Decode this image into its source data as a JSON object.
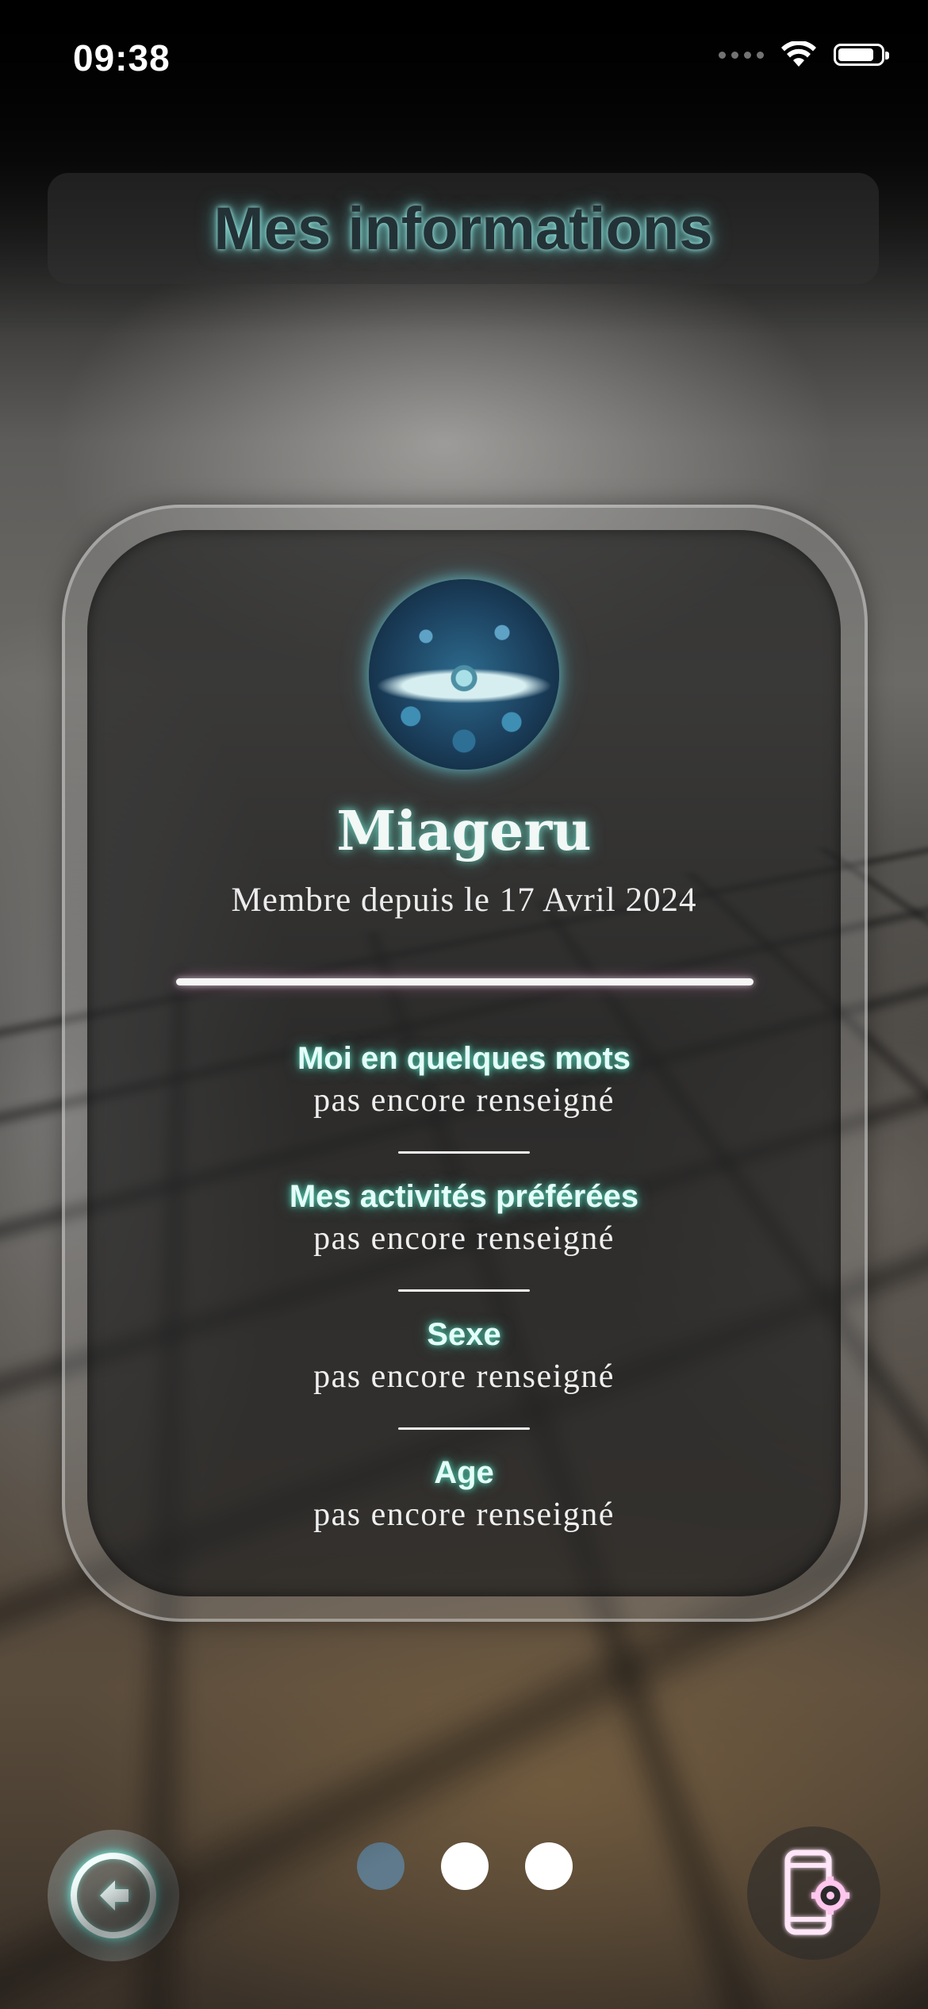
{
  "status_bar": {
    "time": "09:38"
  },
  "header": {
    "title": "Mes informations"
  },
  "profile": {
    "username": "Miageru",
    "member_since": "Membre depuis le 17 Avril 2024",
    "fields": [
      {
        "label": "Moi en quelques mots",
        "value": "pas encore renseigné"
      },
      {
        "label": "Mes activités préférées",
        "value": "pas encore renseigné"
      },
      {
        "label": "Sexe",
        "value": "pas encore renseigné"
      },
      {
        "label": "Age",
        "value": "pas encore renseigné"
      }
    ]
  },
  "pagination": {
    "total_pages": 3,
    "current_page": 1
  },
  "icons": {
    "back": "back-arrow-icon",
    "settings": "phone-settings-icon",
    "wifi": "wifi-icon",
    "battery": "battery-icon"
  },
  "colors": {
    "accent_glow": "#5fe0cf",
    "settings_glow": "#ff8fe0",
    "pager_active": "#5e7a8c",
    "pager_inactive": "#ffffff"
  }
}
